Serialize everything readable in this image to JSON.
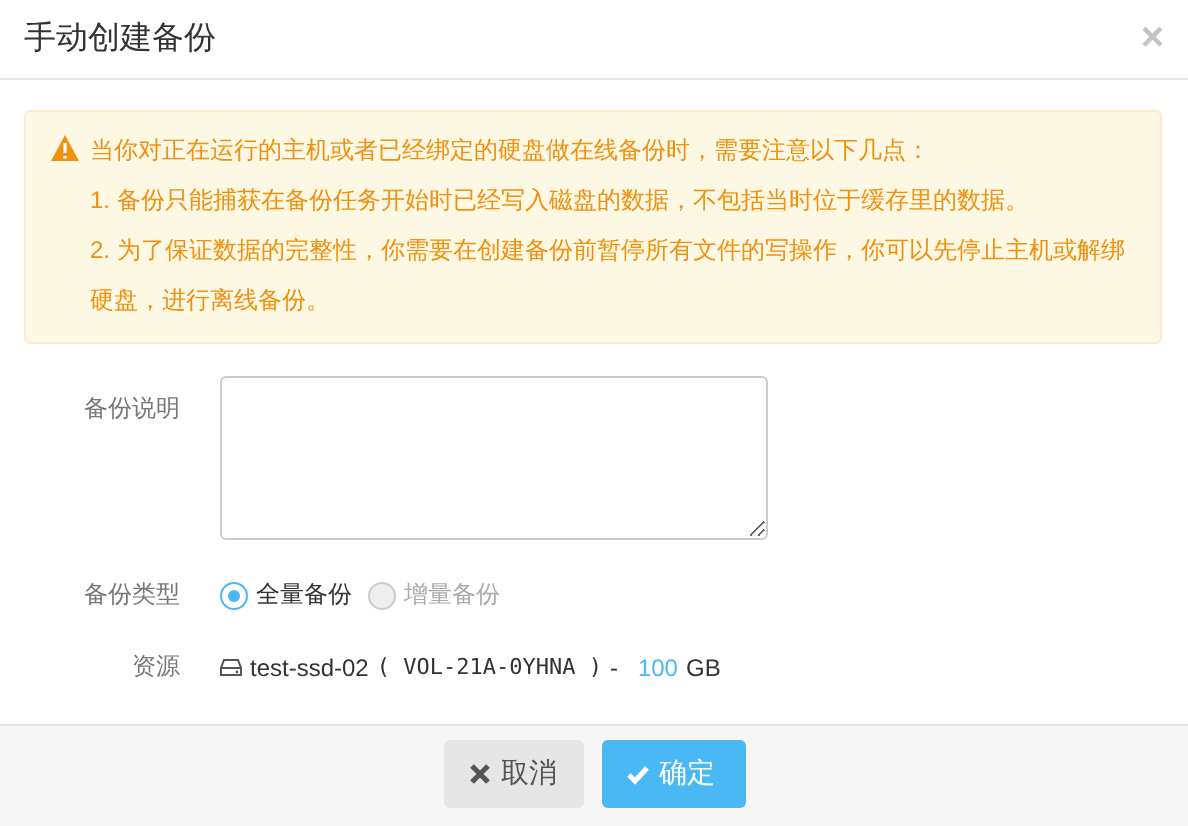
{
  "dialog": {
    "title": "手动创建备份",
    "close": "×"
  },
  "alert": {
    "lines": [
      "当你对正在运行的主机或者已经绑定的硬盘做在线备份时，需要注意以下几点：",
      "1. 备份只能捕获在备份任务开始时已经写入磁盘的数据，不包括当时位于缓存里的数据。",
      "2. 为了保证数据的完整性，你需要在创建备份前暂停所有文件的写操作，你可以先停止主机或解绑硬盘，进行离线备份。"
    ]
  },
  "form": [
    {
      "kind": "textarea",
      "label": "备份说明"
    },
    {
      "kind": "radios",
      "label": "备份类型",
      "options": [
        {
          "label": "全量备份",
          "selected": true,
          "disabled": false
        },
        {
          "label": "增量备份",
          "selected": false,
          "disabled": true
        }
      ]
    },
    {
      "kind": "resource",
      "label": "资源",
      "name": "test-ssd-02",
      "id": "( VOL-21A-0YHNA )",
      "separator": "-",
      "size": "100",
      "unit": "GB"
    }
  ],
  "buttons": [
    {
      "kind": "cancel",
      "label": "取消"
    },
    {
      "kind": "confirm",
      "label": "确定"
    }
  ]
}
